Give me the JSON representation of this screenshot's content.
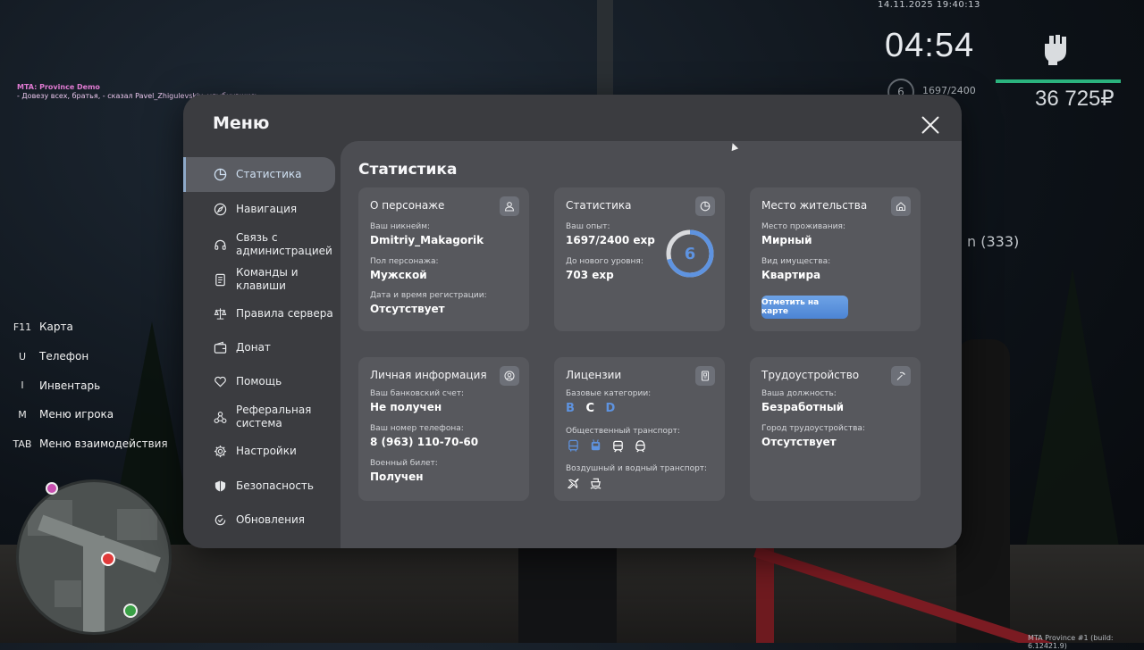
{
  "hud": {
    "datetime": "14.11.2025 19:40:13",
    "clock": "04:54",
    "level": "6",
    "exp": "1697/2400",
    "money": "36 725₽",
    "side_text": "n (333)",
    "build": "MTA Province #1 (build: 6.12421.9)",
    "health_color": "#2bb37e"
  },
  "chat": {
    "source": "MTA: Province Demo",
    "message": "- Довезу всех, братья, - сказал Pavel_Zhigulevskiy, улыбнувшись."
  },
  "hotkeys": [
    {
      "key": "F11",
      "label": "Карта"
    },
    {
      "key": "U",
      "label": "Телефон"
    },
    {
      "key": "I",
      "label": "Инвентарь"
    },
    {
      "key": "M",
      "label": "Меню игрока"
    },
    {
      "key": "TAB",
      "label": "Меню взаимодействия"
    }
  ],
  "menu": {
    "title": "Меню",
    "nav": [
      {
        "label": "Статистика",
        "icon": "pie-chart-icon",
        "active": true
      },
      {
        "label": "Навигация",
        "icon": "compass-icon"
      },
      {
        "label": "Связь с администрацией",
        "icon": "headset-icon"
      },
      {
        "label": "Команды и клавиши",
        "icon": "document-icon"
      },
      {
        "label": "Правила сервера",
        "icon": "scales-icon"
      },
      {
        "label": "Донат",
        "icon": "wallet-icon"
      },
      {
        "label": "Помощь",
        "icon": "heart-hands-icon"
      },
      {
        "label": "Реферальная система",
        "icon": "people-network-icon"
      },
      {
        "label": "Настройки",
        "icon": "gear-icon"
      },
      {
        "label": "Безопасность",
        "icon": "shield-icon"
      },
      {
        "label": "Обновления",
        "icon": "refresh-check-icon"
      }
    ],
    "section_title": "Статистика",
    "cards": {
      "character": {
        "title": "О персонаже",
        "nick_label": "Ваш никнейм:",
        "nick": "Dmitriy_Makagorik",
        "gender_label": "Пол персонажа:",
        "gender": "Мужской",
        "reg_label": "Дата и время регистрации:",
        "reg": "Отсутствует"
      },
      "stats": {
        "title": "Статистика",
        "exp_label": "Ваш опыт:",
        "exp": "1697/2400 exp",
        "next_label": "До нового уровня:",
        "next": "703 exp",
        "level": "6",
        "progress": 0.707,
        "ring_color": "#5e93e0"
      },
      "residence": {
        "title": "Место жительства",
        "place_label": "Место проживания:",
        "place": "Мирный",
        "type_label": "Вид имущества:",
        "type": "Квартира",
        "button": "Отметить на карте"
      },
      "personal": {
        "title": "Личная информация",
        "bank_label": "Ваш банковский счет:",
        "bank": "Не получен",
        "phone_label": "Ваш номер телефона:",
        "phone": "8 (963) 110-70-60",
        "military_label": "Военный билет:",
        "military": "Получен"
      },
      "licenses": {
        "title": "Лицензии",
        "base_label": "Базовые категории:",
        "categories": [
          {
            "letter": "B",
            "color": "#5e93e0"
          },
          {
            "letter": "C",
            "color": "#ffffff"
          },
          {
            "letter": "D",
            "color": "#5e93e0"
          }
        ],
        "public_label": "Общественный транспорт:",
        "air_label": "Воздушный и водный транспорт:"
      },
      "employment": {
        "title": "Трудоустройство",
        "position_label": "Ваша должность:",
        "position": "Безработный",
        "city_label": "Город трудоустройства:",
        "city": "Отсутствует"
      }
    }
  }
}
